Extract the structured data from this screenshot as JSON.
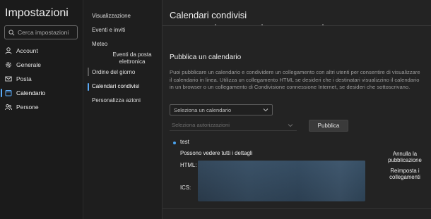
{
  "app": {
    "title": "Impostazioni"
  },
  "search": {
    "placeholder": "Cerca impostazioni"
  },
  "nav_main": [
    {
      "label": "Account",
      "icon": "person-icon",
      "active": false
    },
    {
      "label": "Generale",
      "icon": "gear-icon",
      "active": false
    },
    {
      "label": "Posta",
      "icon": "mail-icon",
      "active": false
    },
    {
      "label": "Calendario",
      "icon": "calendar-icon",
      "active": true
    },
    {
      "label": "Persone",
      "icon": "people-icon",
      "active": false
    }
  ],
  "nav_sub": {
    "visualizzazione": "Visualizzazione",
    "eventi": "Eventi e inviti",
    "meteo": "Meteo",
    "eventi_posta": "Eventi da posta elettronica",
    "ordine": "Ordine del giorno",
    "condivisi": "Calendari condivisi",
    "azioni": "Personalizza azioni"
  },
  "pane": {
    "title": "Calendari condivisi",
    "section_title": "Pubblica un calendario",
    "description": "Puoi pubblicare un calendario e condividere un collegamento con altri utenti per consentire di visualizzare il calendario in linea. Utilizza un collegamento HTML se desideri che i destinatari visualizzino il calendario in un browser o un collegamento di Condivisione connessione Internet, se desideri che sottoscrivano.",
    "select_calendar": "Seleziona un calendario",
    "select_permissions": "Seleziona autorizzazioni",
    "publish_button": "Pubblica",
    "published_calendar": "test",
    "permission_text": "Possono vedere tutti i dettagli",
    "html_label": "HTML:",
    "ics_label": "ICS:",
    "unpublish": "Annulla la pubblicazione",
    "reset_links": "Reimposta i collegamenti"
  },
  "colors": {
    "accent": "#5aa9f5",
    "background": "#1f1f1f"
  }
}
